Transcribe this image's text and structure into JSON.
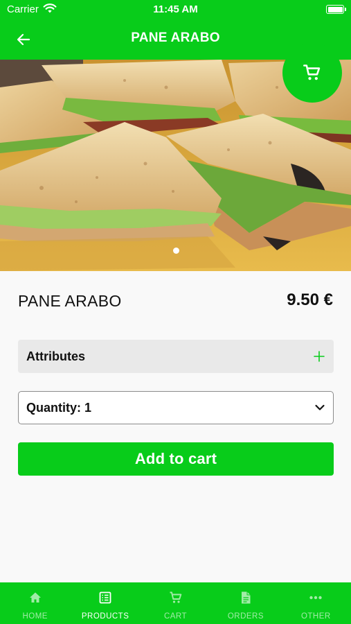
{
  "status_bar": {
    "carrier": "Carrier",
    "time": "11:45 AM"
  },
  "nav": {
    "title": "PANE ARABO",
    "back_icon": "arrow-left-icon"
  },
  "hero": {
    "image_alt": "Pane arabo sandwiches",
    "page_dots": 1,
    "cart_icon": "cart-icon"
  },
  "product": {
    "name": "PANE ARABO",
    "price": "9.50 €"
  },
  "attributes": {
    "label": "Attributes",
    "expand_icon": "plus-icon"
  },
  "quantity": {
    "label": "Quantity: 1"
  },
  "add_to_cart": {
    "label": "Add to cart"
  },
  "tab_bar": {
    "items": [
      {
        "label": "HOME",
        "icon": "home-icon",
        "active": false
      },
      {
        "label": "PRODUCTS",
        "icon": "list-icon",
        "active": true
      },
      {
        "label": "CART",
        "icon": "cart-icon",
        "active": false
      },
      {
        "label": "ORDERS",
        "icon": "document-icon",
        "active": false
      },
      {
        "label": "OTHER",
        "icon": "more-icon",
        "active": false
      }
    ]
  },
  "colors": {
    "brand": "#08cc1a",
    "background": "#f9f9f9",
    "field_bg": "#e9e9e9"
  }
}
